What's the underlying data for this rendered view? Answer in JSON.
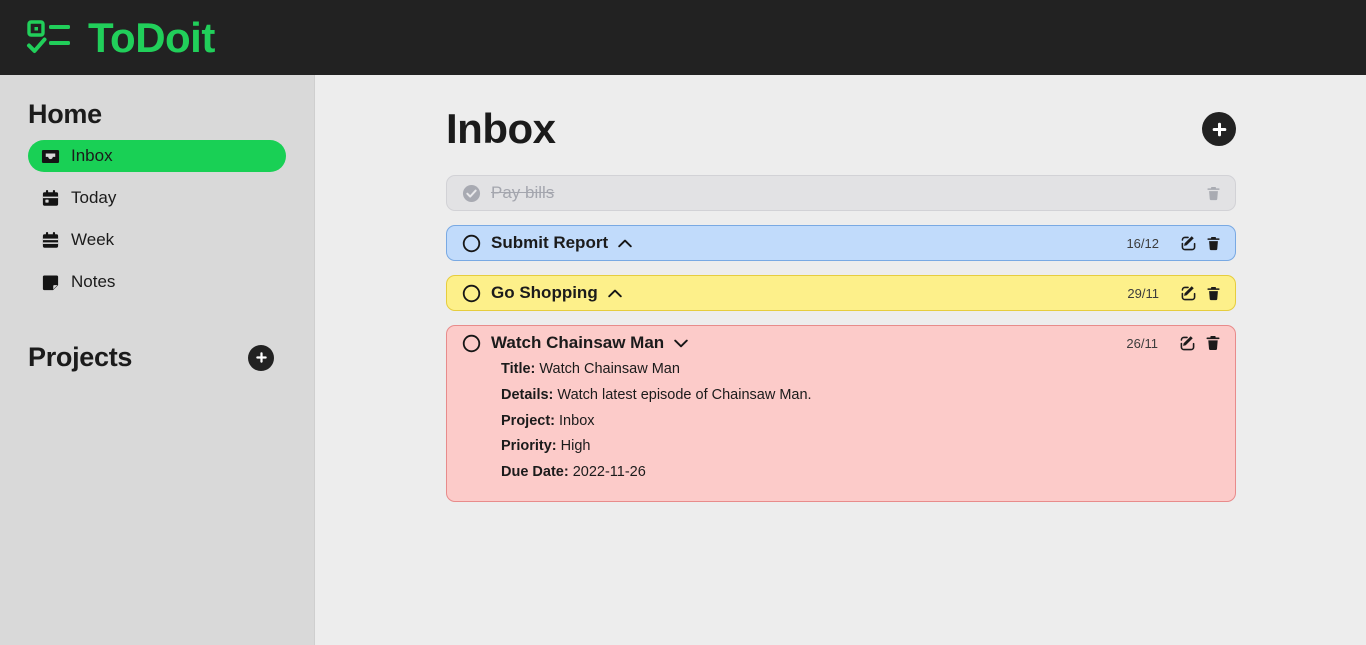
{
  "brand": {
    "name": "ToDoit",
    "icon": "checklist-icon",
    "color": "#21cf5a"
  },
  "sidebar": {
    "home_heading": "Home",
    "projects_heading": "Projects",
    "add_project_label": "+",
    "items": [
      {
        "label": "Inbox",
        "icon": "inbox-icon",
        "active": true
      },
      {
        "label": "Today",
        "icon": "calendar-day-icon",
        "active": false
      },
      {
        "label": "Week",
        "icon": "calendar-week-icon",
        "active": false
      },
      {
        "label": "Notes",
        "icon": "sticky-note-icon",
        "active": false
      }
    ]
  },
  "main": {
    "page_title": "Inbox",
    "add_task_label": "+",
    "tasks": [
      {
        "title": "Pay bills",
        "state": "done",
        "color": "grey",
        "date": "",
        "expanded": false,
        "show_actions": false
      },
      {
        "title": "Submit Report",
        "state": "open",
        "color": "blue",
        "date": "16/12",
        "expanded": false,
        "chevron": "chevron-up",
        "show_actions": true
      },
      {
        "title": "Go Shopping",
        "state": "open",
        "color": "yellow",
        "date": "29/11",
        "expanded": false,
        "chevron": "chevron-up",
        "show_actions": true
      },
      {
        "title": "Watch Chainsaw Man",
        "state": "open",
        "color": "pink",
        "date": "26/11",
        "expanded": true,
        "chevron": "chevron-down",
        "show_actions": true,
        "details": {
          "title_key": "Title:",
          "title_value": "Watch Chainsaw Man",
          "details_key": "Details:",
          "details_value": "Watch latest episode of Chainsaw Man.",
          "project_key": "Project:",
          "project_value": "Inbox",
          "priority_key": "Priority:",
          "priority_value": "High",
          "due_key": "Due Date:",
          "due_value": "2022-11-26"
        }
      }
    ]
  },
  "colors": {
    "brand_green": "#21cf5a",
    "active_green": "#19d055",
    "topbar": "#222222",
    "sidebar": "#d9d9d9",
    "main_bg": "#ededed",
    "blue_task": "#c1dbfb",
    "yellow_task": "#fdf08a",
    "pink_task": "#fccbc9",
    "done_task": "#e2e2e4"
  }
}
